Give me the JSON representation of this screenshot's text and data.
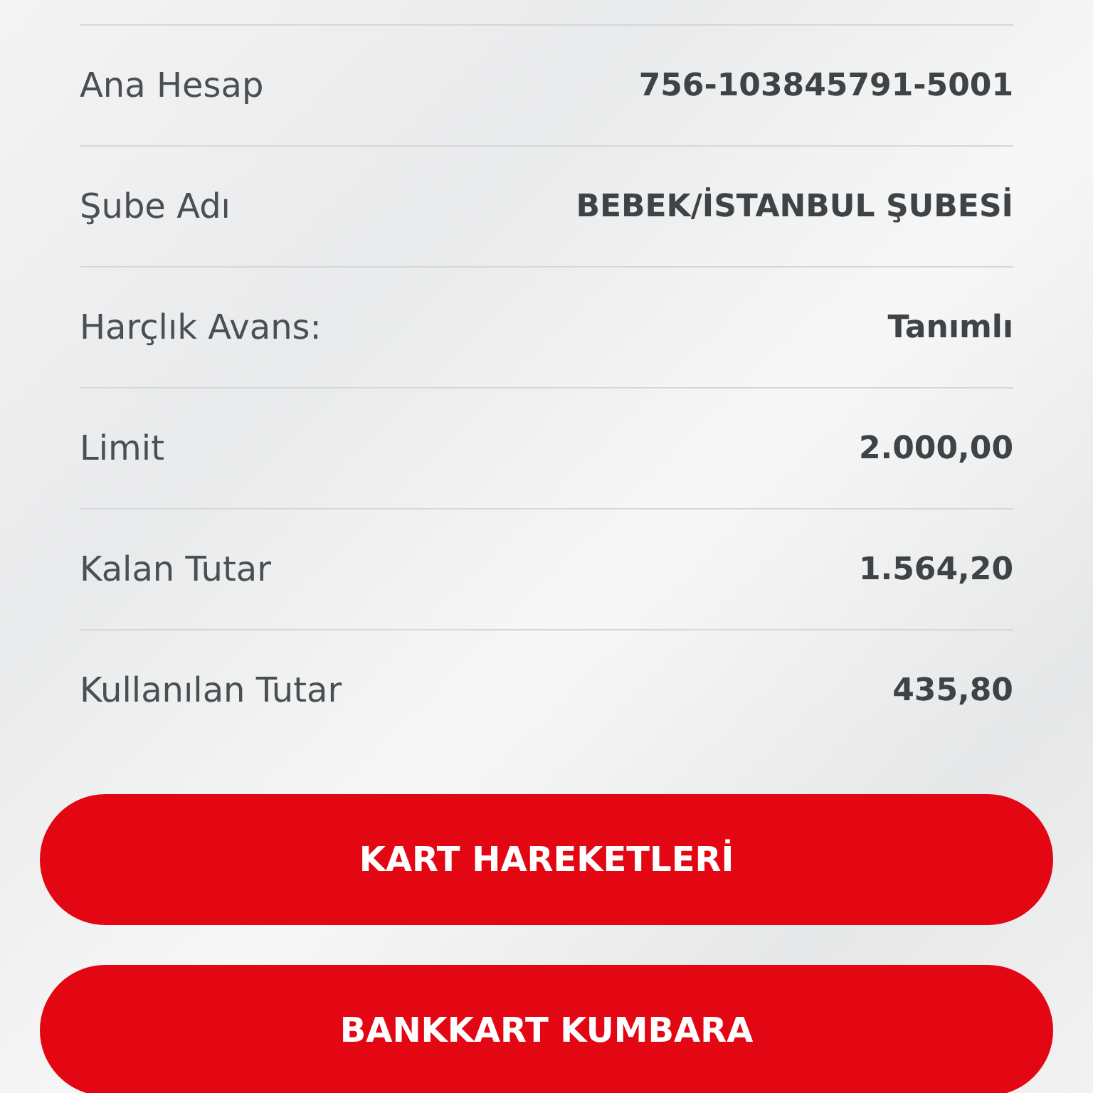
{
  "details": [
    {
      "label": "Ana Hesap",
      "value": "756-103845791-5001"
    },
    {
      "label": "Şube Adı",
      "value": "BEBEK/İSTANBUL ŞUBESİ"
    },
    {
      "label": "Harçlık Avans:",
      "value": "Tanımlı"
    },
    {
      "label": "Limit",
      "value": "2.000,00"
    },
    {
      "label": "Kalan Tutar",
      "value": "1.564,20"
    },
    {
      "label": "Kullanılan Tutar",
      "value": "435,80"
    }
  ],
  "buttons": [
    "KART HAREKETLERİ",
    "BANKKART KUMBARA"
  ]
}
